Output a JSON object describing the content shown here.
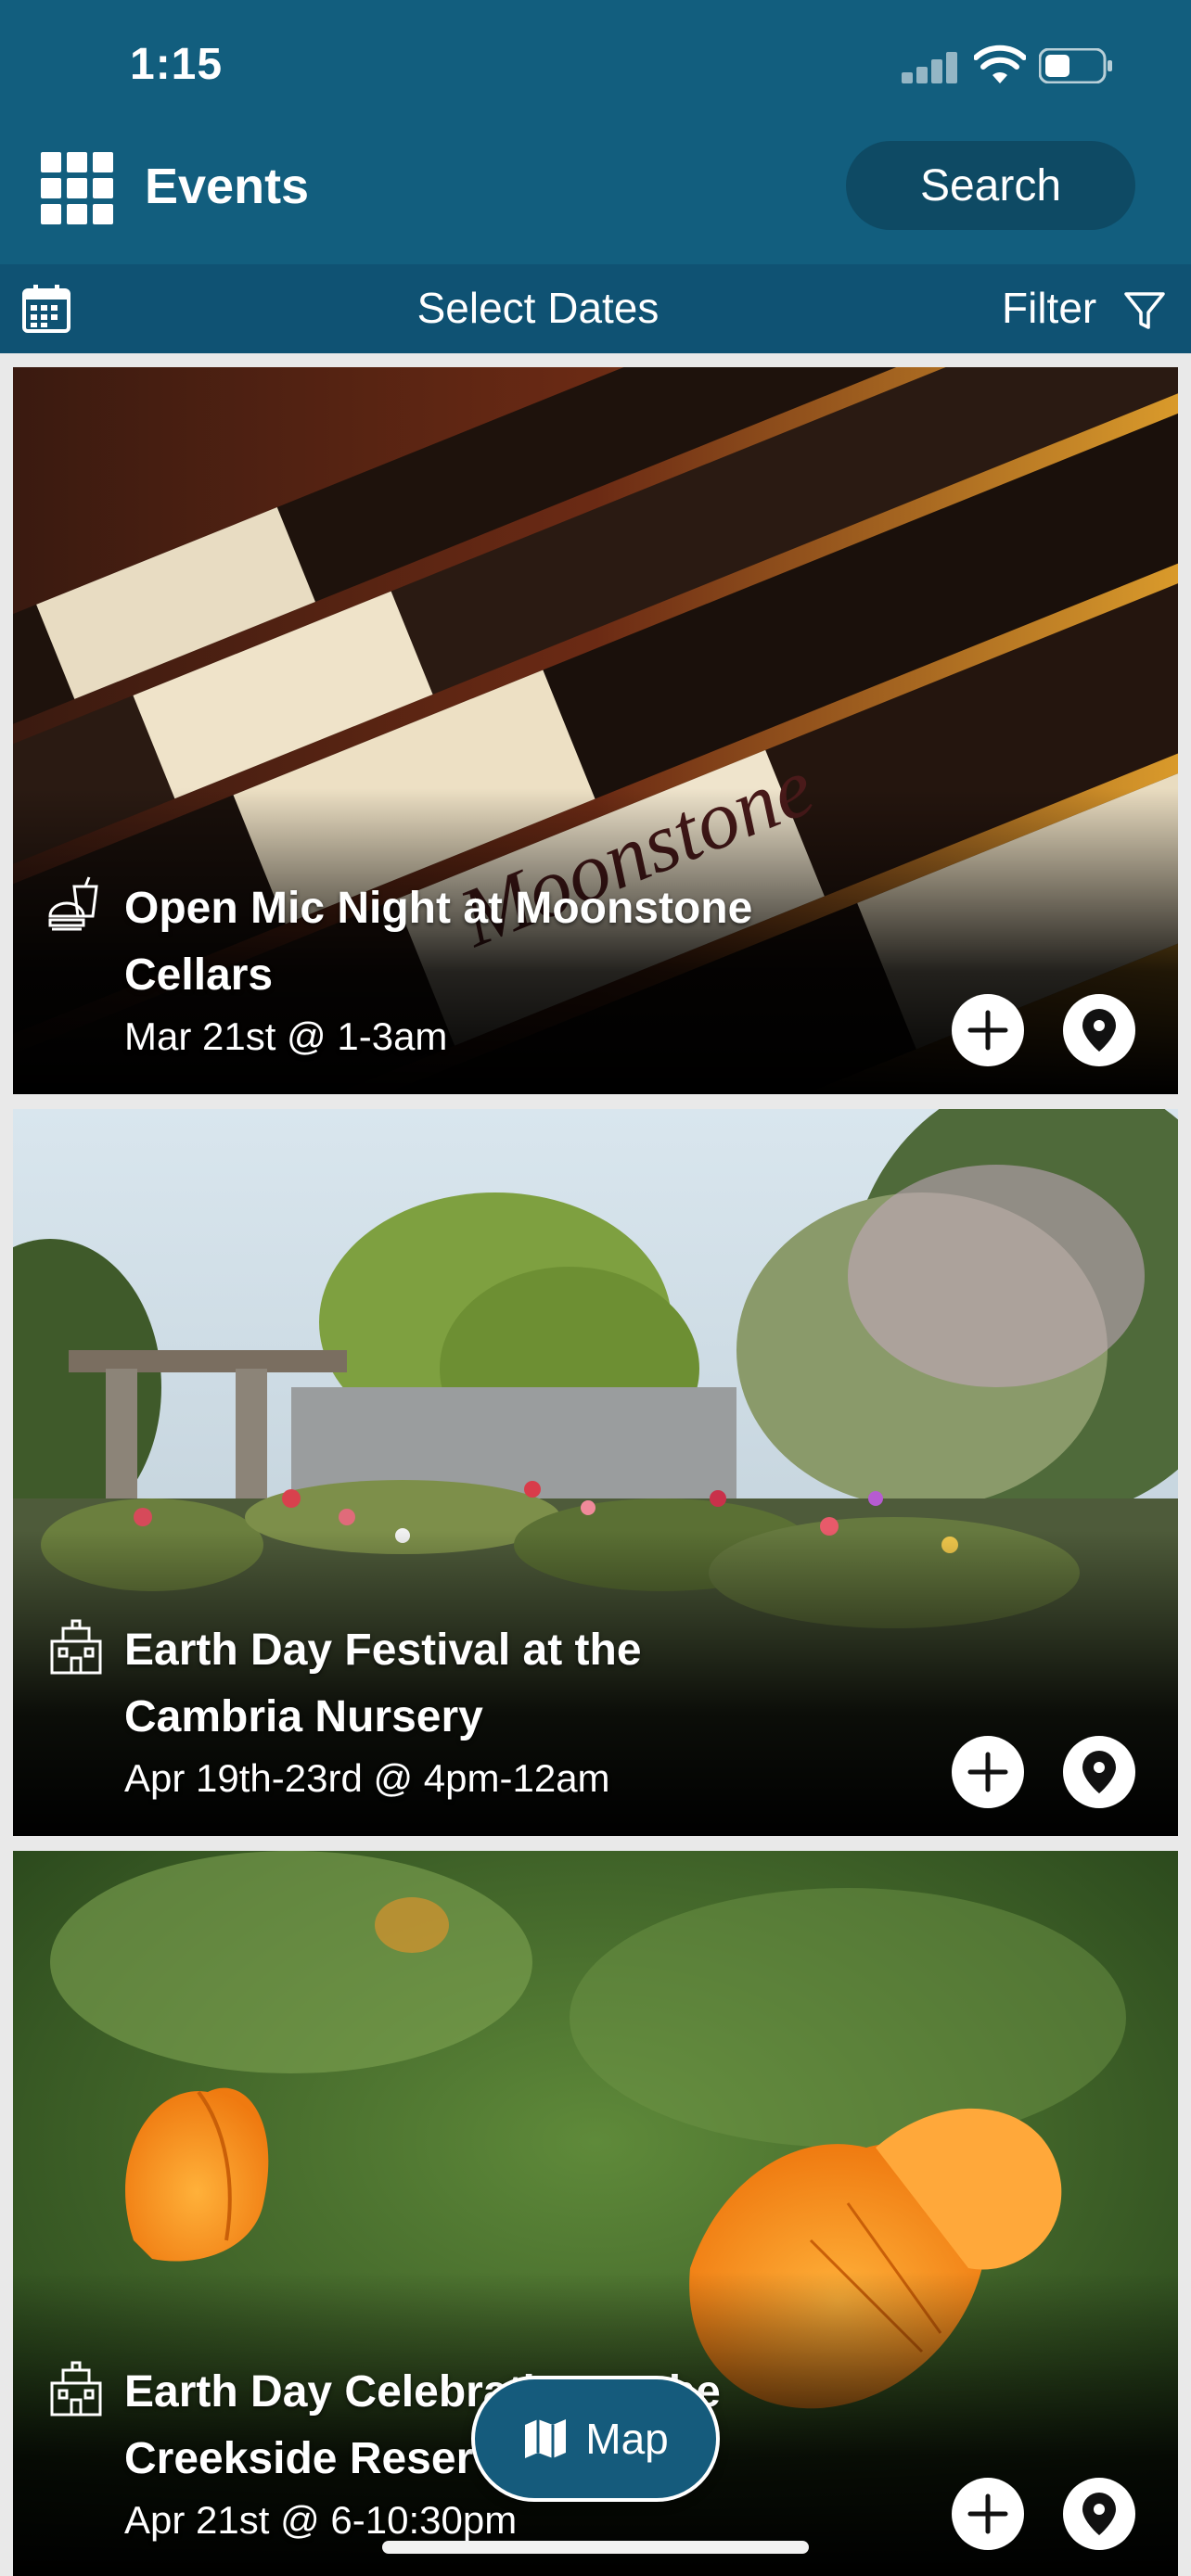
{
  "status_bar": {
    "time": "1:15"
  },
  "header": {
    "title": "Events",
    "search_label": "Search"
  },
  "date_bar": {
    "select_dates": "Select Dates",
    "filter": "Filter"
  },
  "events": [
    {
      "title": "Open Mic Night at Moonstone Cellars",
      "date": "Mar 21st @ 1-3am",
      "category_icon": "food-drink-icon"
    },
    {
      "title": "Earth Day Festival at the Cambria Nursery",
      "date": "Apr 19th-23rd @ 4pm-12am",
      "category_icon": "building-icon"
    },
    {
      "title": "Earth Day Celebration at the Creekside Reserve",
      "date": "Apr 21st @ 6-10:30pm",
      "category_icon": "building-icon"
    }
  ],
  "map_button": {
    "label": "Map"
  },
  "colors": {
    "header": "#125e7e",
    "datebar": "#0f5273",
    "accent": "#155b7c"
  }
}
